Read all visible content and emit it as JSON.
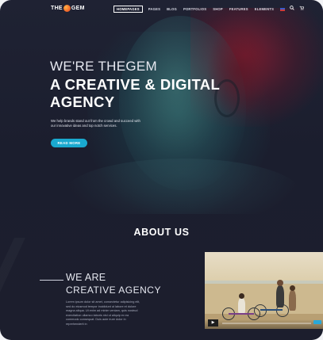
{
  "header": {
    "logo_left": "THE",
    "logo_right": "GEM",
    "nav": [
      "HOMEPAGES",
      "PAGES",
      "BLOG",
      "PORTFOLIOS",
      "SHOP",
      "FEATURES",
      "ELEMENTS"
    ],
    "search_icon": "🔍",
    "cart_icon": "🛒"
  },
  "hero": {
    "subtitle": "WE'RE THEGEM",
    "title": "A CREATIVE & DIGITAL AGENCY",
    "description": "We help brands stand out from the crowd and succeed with our innovative ideas and top notch services.",
    "cta_label": "READ MORE"
  },
  "about": {
    "title": "ABOUT US",
    "we_are": "WE ARE",
    "creative_agency": "CREATIVE AGENCY",
    "body": "Lorem ipsum dolor sit amet, consectetur adipisicing elit, sed do eiusmod tempor incididunt ut labore et dolore magna aliqua. Ut enim ad minim veniam, quis nostrud exercitation ullamco laboris nisi ut aliquip ex ea commodo consequat. Duis aute irure dolor in reprehenderit in"
  },
  "video": {
    "play_icon": "▶"
  },
  "colors": {
    "accent": "#1aa9cf",
    "background": "#1f2233"
  }
}
